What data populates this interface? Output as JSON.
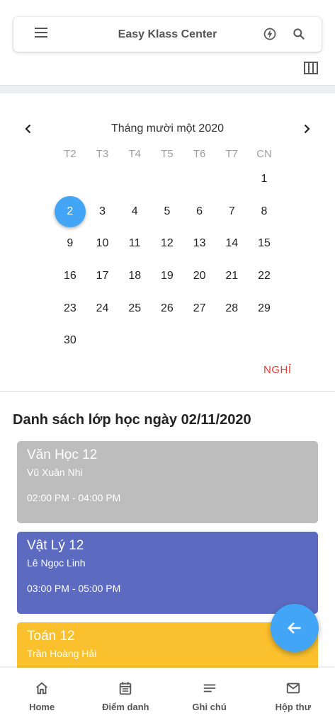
{
  "appbar": {
    "title": "Easy Klass Center"
  },
  "calendar": {
    "month_label": "Tháng mười một 2020",
    "weekdays": [
      "T2",
      "T3",
      "T4",
      "T5",
      "T6",
      "T7",
      "CN"
    ],
    "weeks": [
      [
        "",
        "",
        "",
        "",
        "",
        "",
        "1"
      ],
      [
        "2",
        "3",
        "4",
        "5",
        "6",
        "7",
        "8"
      ],
      [
        "9",
        "10",
        "11",
        "12",
        "13",
        "14",
        "15"
      ],
      [
        "16",
        "17",
        "18",
        "19",
        "20",
        "21",
        "22"
      ],
      [
        "23",
        "24",
        "25",
        "26",
        "27",
        "28",
        "29"
      ],
      [
        "30",
        "",
        "",
        "",
        "",
        "",
        ""
      ]
    ],
    "selected_day": "2",
    "selected_color": "#42a5f5",
    "action_label": "NGHỈ"
  },
  "class_list": {
    "title": "Danh sách lớp học ngày 02/11/2020",
    "items": [
      {
        "name": "Văn Học 12",
        "teacher": "Vũ Xuân Nhi",
        "time": "02:00 PM - 04:00 PM",
        "color": "#bdbdbd"
      },
      {
        "name": "Vật Lý 12",
        "teacher": "Lê Ngọc Linh",
        "time": "03:00 PM - 05:00 PM",
        "color": "#5c6bc0"
      },
      {
        "name": "Toán 12",
        "teacher": "Trần Hoàng Hải",
        "time": "",
        "color": "#fbc02d"
      }
    ]
  },
  "bottom_nav": {
    "items": [
      {
        "label": "Home",
        "icon": "home-icon"
      },
      {
        "label": "Điểm danh",
        "icon": "calendar-check-icon"
      },
      {
        "label": "Ghi chú",
        "icon": "notes-icon"
      },
      {
        "label": "Hộp thư",
        "icon": "mail-icon"
      }
    ]
  }
}
